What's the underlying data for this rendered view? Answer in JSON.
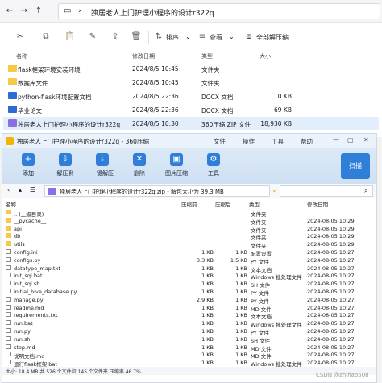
{
  "explorer": {
    "breadcrumb": "独居老人上门护理小程序的设计r322q",
    "ribbon": {
      "sort": "排序",
      "view": "查看",
      "extract_all": "全部解压缩"
    },
    "headers": {
      "name": "名称",
      "modified": "修改日期",
      "type": "类型",
      "size": "大小"
    },
    "files": [
      {
        "name": "flask框架环境安装环境",
        "date": "2024/8/5 10:45",
        "type": "文件夹",
        "size": "",
        "kind": "folder"
      },
      {
        "name": "数据库文件",
        "date": "2024/8/5 10:45",
        "type": "文件夹",
        "size": "",
        "kind": "folder"
      },
      {
        "name": "python-flask环境配置文档",
        "date": "2024/8/5 22:36",
        "type": "DOCX 文档",
        "size": "10 KB",
        "kind": "doc"
      },
      {
        "name": "毕业论文",
        "date": "2024/8/5 22:36",
        "type": "DOCX 文档",
        "size": "69 KB",
        "kind": "doc"
      },
      {
        "name": "独居老人上门护理小程序的设计r322q",
        "date": "2024/8/5 10:30",
        "type": "360压缩 ZIP 文件",
        "size": "18,930 KB",
        "kind": "zip"
      }
    ]
  },
  "zip": {
    "title": "独居老人上门护理小程序的设计r322q - 360压缩",
    "menus": [
      "文件",
      "操作",
      "工具",
      "帮助"
    ],
    "tools": [
      {
        "label": "添加",
        "icon": "+"
      },
      {
        "label": "解压到",
        "icon": "⇩"
      },
      {
        "label": "一键解压",
        "icon": "⇣"
      },
      {
        "label": "删除",
        "icon": "✕"
      },
      {
        "label": "图片压缩",
        "icon": "▣"
      },
      {
        "label": "工具",
        "icon": "⚙"
      }
    ],
    "scan": "扫描",
    "path": "独居老人上门护理小程序的设计r322q.zip - 解包大小为 39.3 MB",
    "headers": {
      "name": "名称",
      "compressed": "压缩前",
      "size": "压缩后",
      "type": "类型",
      "modified": "修改日期"
    },
    "rows": [
      {
        "name": ".. (上级目录)",
        "c": "",
        "s": "",
        "type": "文件夹",
        "date": "",
        "kind": "folder"
      },
      {
        "name": "__pycache__",
        "c": "",
        "s": "",
        "type": "文件夹",
        "date": "2024-08-05 10:29",
        "kind": "folder"
      },
      {
        "name": "api",
        "c": "",
        "s": "",
        "type": "文件夹",
        "date": "2024-08-05 10:29",
        "kind": "folder"
      },
      {
        "name": "db",
        "c": "",
        "s": "",
        "type": "文件夹",
        "date": "2024-08-05 10:29",
        "kind": "folder"
      },
      {
        "name": "utils",
        "c": "",
        "s": "",
        "type": "文件夹",
        "date": "2024-08-05 10:29",
        "kind": "folder"
      },
      {
        "name": "config.ini",
        "c": "1 KB",
        "s": "1 KB",
        "type": "配置设置",
        "date": "2024-08-05 10:27",
        "kind": "file"
      },
      {
        "name": "configs.py",
        "c": "3.3 KB",
        "s": "1.5 KB",
        "type": "PY 文件",
        "date": "2024-08-05 10:27",
        "kind": "file"
      },
      {
        "name": "datatype_map.txt",
        "c": "1 KB",
        "s": "1 KB",
        "type": "文本文档",
        "date": "2024-08-05 10:27",
        "kind": "file"
      },
      {
        "name": "init_sql.bat",
        "c": "1 KB",
        "s": "1 KB",
        "type": "Windows 批处理文件",
        "date": "2024-08-05 10:27",
        "kind": "file"
      },
      {
        "name": "init_sql.sh",
        "c": "1 KB",
        "s": "1 KB",
        "type": "SH 文件",
        "date": "2024-08-05 10:27",
        "kind": "file"
      },
      {
        "name": "initial_hive_database.py",
        "c": "1 KB",
        "s": "1 KB",
        "type": "PY 文件",
        "date": "2024-08-05 10:27",
        "kind": "file"
      },
      {
        "name": "manage.py",
        "c": "2.9 KB",
        "s": "1 KB",
        "type": "PY 文件",
        "date": "2024-08-05 10:27",
        "kind": "file"
      },
      {
        "name": "readme.md",
        "c": "1 KB",
        "s": "1 KB",
        "type": "MD 文件",
        "date": "2024-08-05 10:27",
        "kind": "file"
      },
      {
        "name": "requirements.txt",
        "c": "1 KB",
        "s": "1 KB",
        "type": "文本文档",
        "date": "2024-08-05 10:27",
        "kind": "file"
      },
      {
        "name": "run.bat",
        "c": "1 KB",
        "s": "1 KB",
        "type": "Windows 批处理文件",
        "date": "2024-08-05 10:27",
        "kind": "file"
      },
      {
        "name": "run.py",
        "c": "1 KB",
        "s": "1 KB",
        "type": "PY 文件",
        "date": "2024-08-05 10:27",
        "kind": "file"
      },
      {
        "name": "run.sh",
        "c": "1 KB",
        "s": "1 KB",
        "type": "SH 文件",
        "date": "2024-08-05 10:27",
        "kind": "file"
      },
      {
        "name": "step.md",
        "c": "1 KB",
        "s": "1 KB",
        "type": "MD 文件",
        "date": "2024-08-05 10:27",
        "kind": "file"
      },
      {
        "name": "说明文档.md",
        "c": "1 KB",
        "s": "1 KB",
        "type": "MD 文件",
        "date": "2024-08-05 10:27",
        "kind": "file"
      },
      {
        "name": "运行flask框架.bat",
        "c": "1 KB",
        "s": "1 KB",
        "type": "Windows 批处理文件",
        "date": "2024-08-05 10:27",
        "kind": "file"
      }
    ],
    "status": "大小: 18.4 MB 共 526 个文件和 145 个文件夹 压缩率 46.7%"
  },
  "watermark": "CSDN @zhihao508",
  "colors": {
    "accent": "#2f7fd8",
    "folder": "#f7c948",
    "selected": "#e3eefc"
  }
}
